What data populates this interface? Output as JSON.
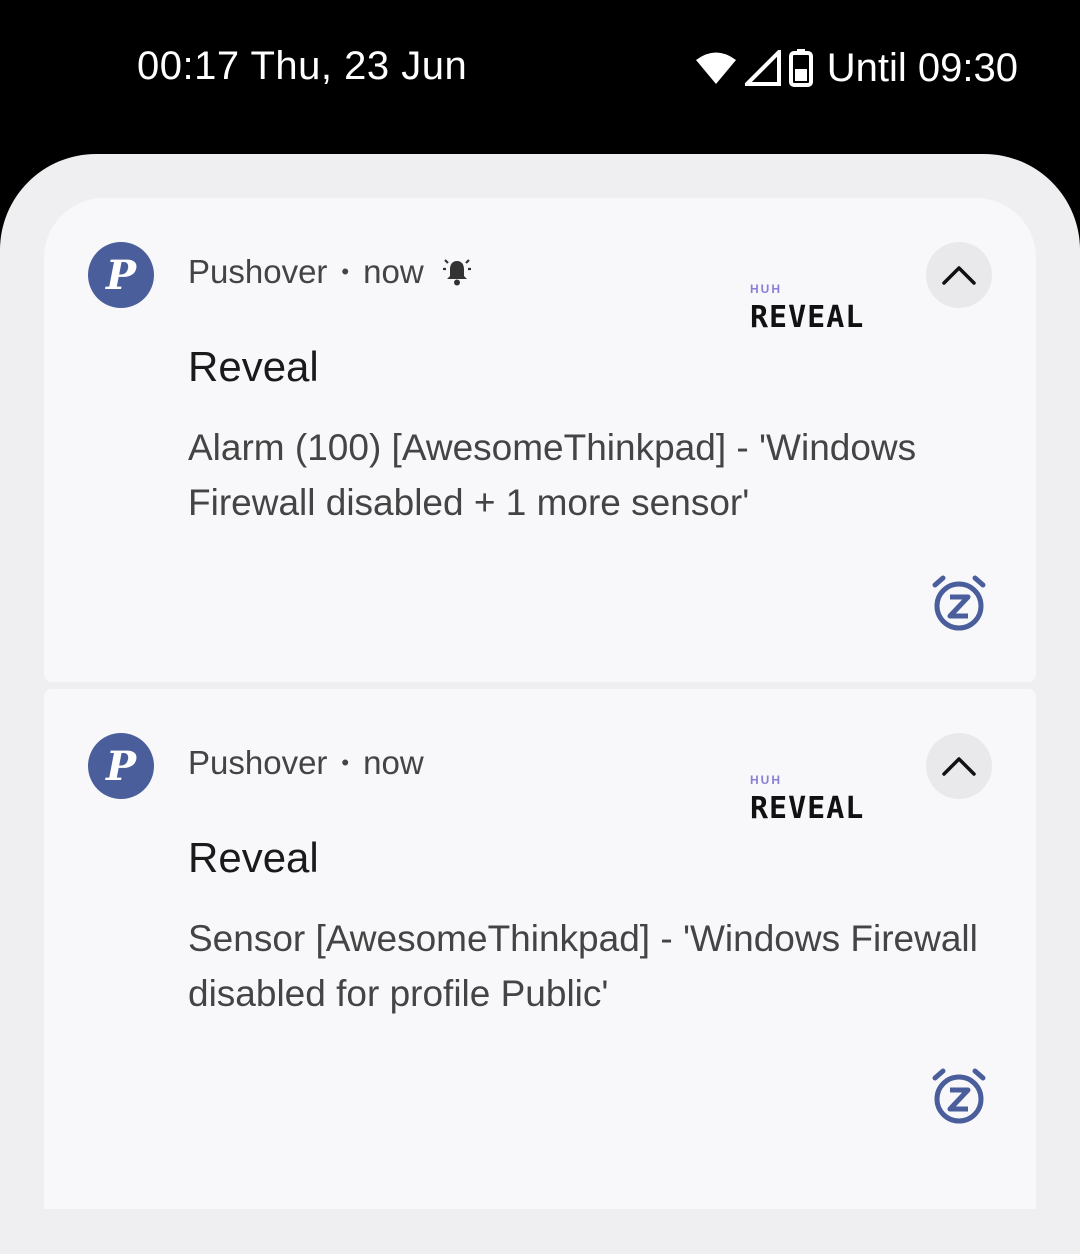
{
  "status_bar": {
    "time": "00:17 Thu, 23 Jun",
    "battery_text": "Until 09:30",
    "icons": [
      "wifi-icon",
      "cell-signal-icon",
      "battery-icon"
    ]
  },
  "notifications": [
    {
      "app_name": "Pushover",
      "separator": "•",
      "time": "now",
      "avatar_letter": "P",
      "thumbnail_small": "HUH",
      "thumbnail_big": "REVEAL",
      "title": "Reveal",
      "body": "Alarm (100) [AwesomeThinkpad] - 'Windows Firewall disabled + 1 more sensor'",
      "has_alert_icon": true
    },
    {
      "app_name": "Pushover",
      "separator": "•",
      "time": "now",
      "avatar_letter": "P",
      "thumbnail_small": "HUH",
      "thumbnail_big": "REVEAL",
      "title": "Reveal",
      "body": "Sensor [AwesomeThinkpad] - 'Windows Firewall disabled for profile Public'",
      "has_alert_icon": false
    }
  ],
  "colors": {
    "accent": "#4b5e9c",
    "shade_bg": "#efeff1",
    "card_bg": "#f8f8fb"
  }
}
